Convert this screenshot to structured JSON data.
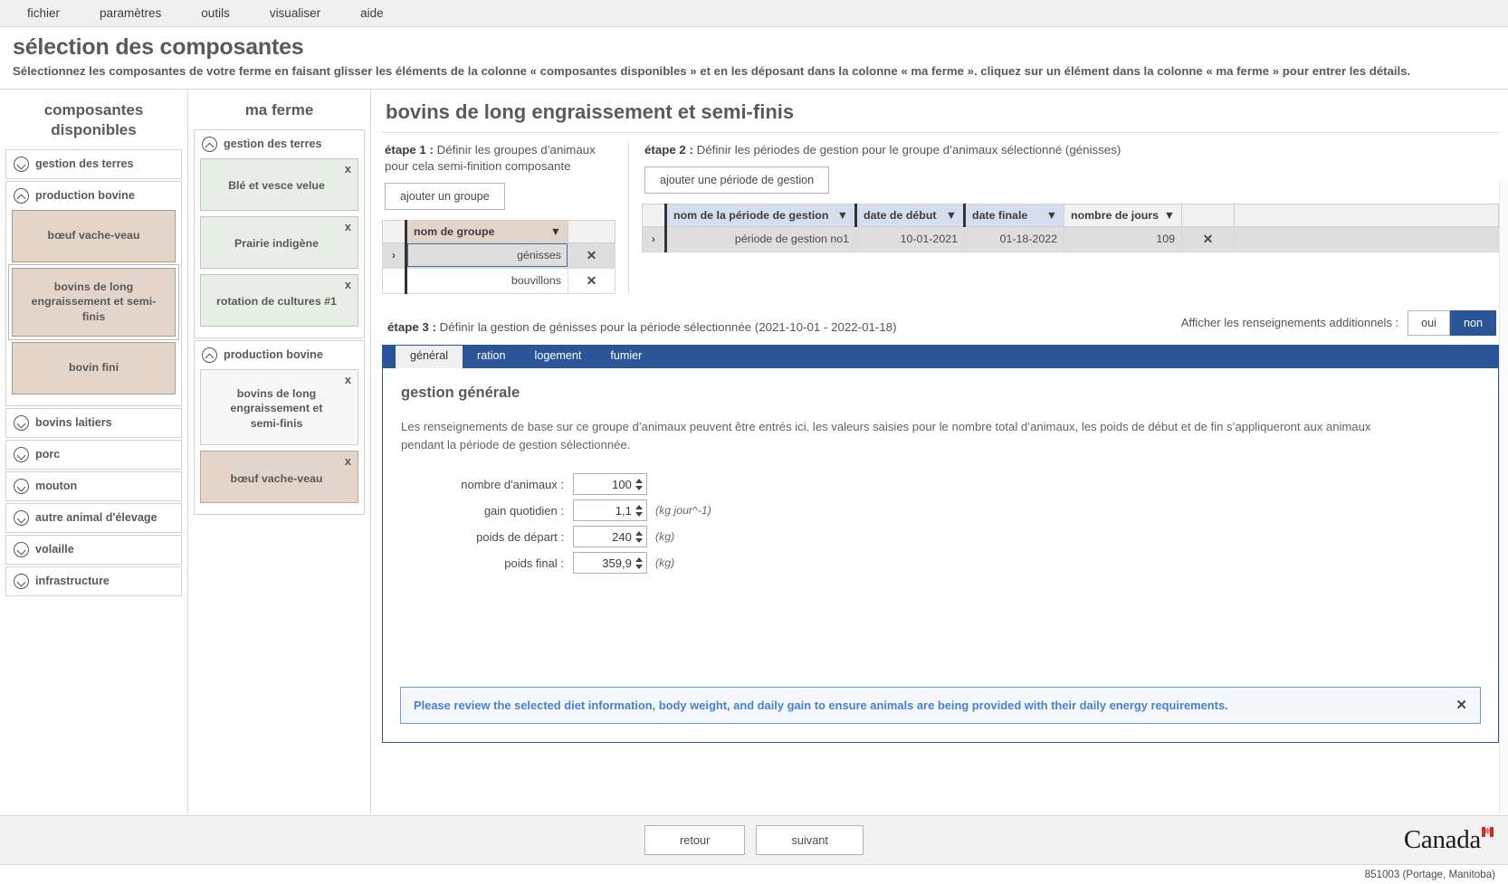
{
  "menubar": {
    "items": [
      {
        "label": "fichier"
      },
      {
        "label": "paramètres"
      },
      {
        "label": "outils"
      },
      {
        "label": "visualiser"
      },
      {
        "label": "aide"
      }
    ]
  },
  "header": {
    "title": "sélection des composantes",
    "subtitle": "Sélectionnez les composantes de votre ferme en faisant glisser les éléments de la colonne « composantes disponibles » et en les déposant dans la colonne « ma ferme ». cliquez sur un élément dans la colonne « ma ferme » pour entrer les détails."
  },
  "available": {
    "heading": "composantes disponibles",
    "groups": [
      {
        "label": "gestion des terres",
        "expanded": false,
        "items": []
      },
      {
        "label": "production bovine",
        "expanded": true,
        "items": [
          {
            "label": "bœuf vache-veau",
            "selected": false
          },
          {
            "label": "bovins de long engraissement et semi-finis",
            "selected": true
          },
          {
            "label": "bovin fini",
            "selected": false
          }
        ]
      },
      {
        "label": "bovins laitiers",
        "expanded": false,
        "items": []
      },
      {
        "label": "porc",
        "expanded": false,
        "items": []
      },
      {
        "label": "mouton",
        "expanded": false,
        "items": []
      },
      {
        "label": "autre animal d'élevage",
        "expanded": false,
        "items": []
      },
      {
        "label": "volaille",
        "expanded": false,
        "items": []
      },
      {
        "label": "infrastructure",
        "expanded": false,
        "items": []
      }
    ]
  },
  "myfarm": {
    "heading": "ma ferme",
    "remove_label": "x",
    "groups": [
      {
        "label": "gestion des terres",
        "expanded": true,
        "items": [
          {
            "label": "Blé et vesce velue",
            "style": "green"
          },
          {
            "label": "Prairie indigène",
            "style": "green"
          },
          {
            "label": "rotation de cultures #1",
            "style": "green"
          }
        ]
      },
      {
        "label": "production bovine",
        "expanded": true,
        "items": [
          {
            "label": "bovins de long engraissement et semi-finis",
            "style": "white"
          },
          {
            "label": "bœuf vache-veau",
            "style": "beef"
          }
        ]
      }
    ]
  },
  "detail": {
    "title": "bovins de long engraissement et semi-finis",
    "step1": {
      "prefix": "étape 1 :",
      "text": " Définir les groupes d’animaux pour cela semi-finition composante",
      "add_button": "ajouter un groupe",
      "columns": [
        "",
        "nom de groupe",
        ""
      ],
      "rows": [
        {
          "expander": "›",
          "name": "génisses",
          "remove": "✕",
          "selected": true
        },
        {
          "expander": "",
          "name": "bouvillons",
          "remove": "✕",
          "selected": false
        }
      ]
    },
    "step2": {
      "prefix": "étape 2 :",
      "text": " Définir les périodes de gestion pour le groupe d’animaux sélectionné (génisses)",
      "add_button": "ajouter une période de gestion",
      "columns": [
        "",
        "nom de la période de gestion",
        "date de début",
        "date finale",
        "nombre de jours",
        "",
        ""
      ],
      "rows": [
        {
          "expander": "›",
          "name": "période de gestion no1",
          "start": "10-01-2021",
          "end": "01-18-2022",
          "days": "109",
          "remove": "✕"
        }
      ]
    },
    "step3": {
      "prefix": "étape 3 :",
      "text": " Définir la gestion de génisses pour la période sélectionnée (2021-10-01 - 2022-01-18)",
      "toggle_label": "Afficher les renseignements additionnels :",
      "toggle_yes": "oui",
      "toggle_no": "non",
      "toggle_value": "non"
    },
    "tabs": [
      {
        "label": "général",
        "active": true
      },
      {
        "label": "ration",
        "active": false
      },
      {
        "label": "logement",
        "active": false
      },
      {
        "label": "fumier",
        "active": false
      }
    ],
    "general": {
      "section_title": "gestion générale",
      "description": "Les renseignements de base sur ce groupe d’animaux peuvent être entrés ici. les valeurs saisies pour le nombre total d’animaux, les poids de début et de fin s’appliqueront aux animaux pendant la période de gestion sélectionnée.",
      "fields": [
        {
          "label": "nombre d'animaux :",
          "value": "100",
          "unit": ""
        },
        {
          "label": "gain quotidien :",
          "value": "1,1",
          "unit": "(kg jour^-1)"
        },
        {
          "label": "poids de départ :",
          "value": "240",
          "unit": "(kg)"
        },
        {
          "label": "poids final :",
          "value": "359,9",
          "unit": "(kg)"
        }
      ]
    },
    "notice": {
      "text": "Please review the selected diet information, body weight, and daily gain to ensure animals are being provided with their daily energy requirements.",
      "close": "✕"
    }
  },
  "footer": {
    "back": "retour",
    "next": "suivant",
    "wordmark": "Canada",
    "flag_glyph": "⁂",
    "status": "851003 (Portage, Manitoba)"
  },
  "colors": {
    "accent_blue": "#2a5699",
    "beef_card": "#e3d5ca",
    "land_card": "#e8efe6",
    "notice_blue": "#4a7fd0"
  }
}
